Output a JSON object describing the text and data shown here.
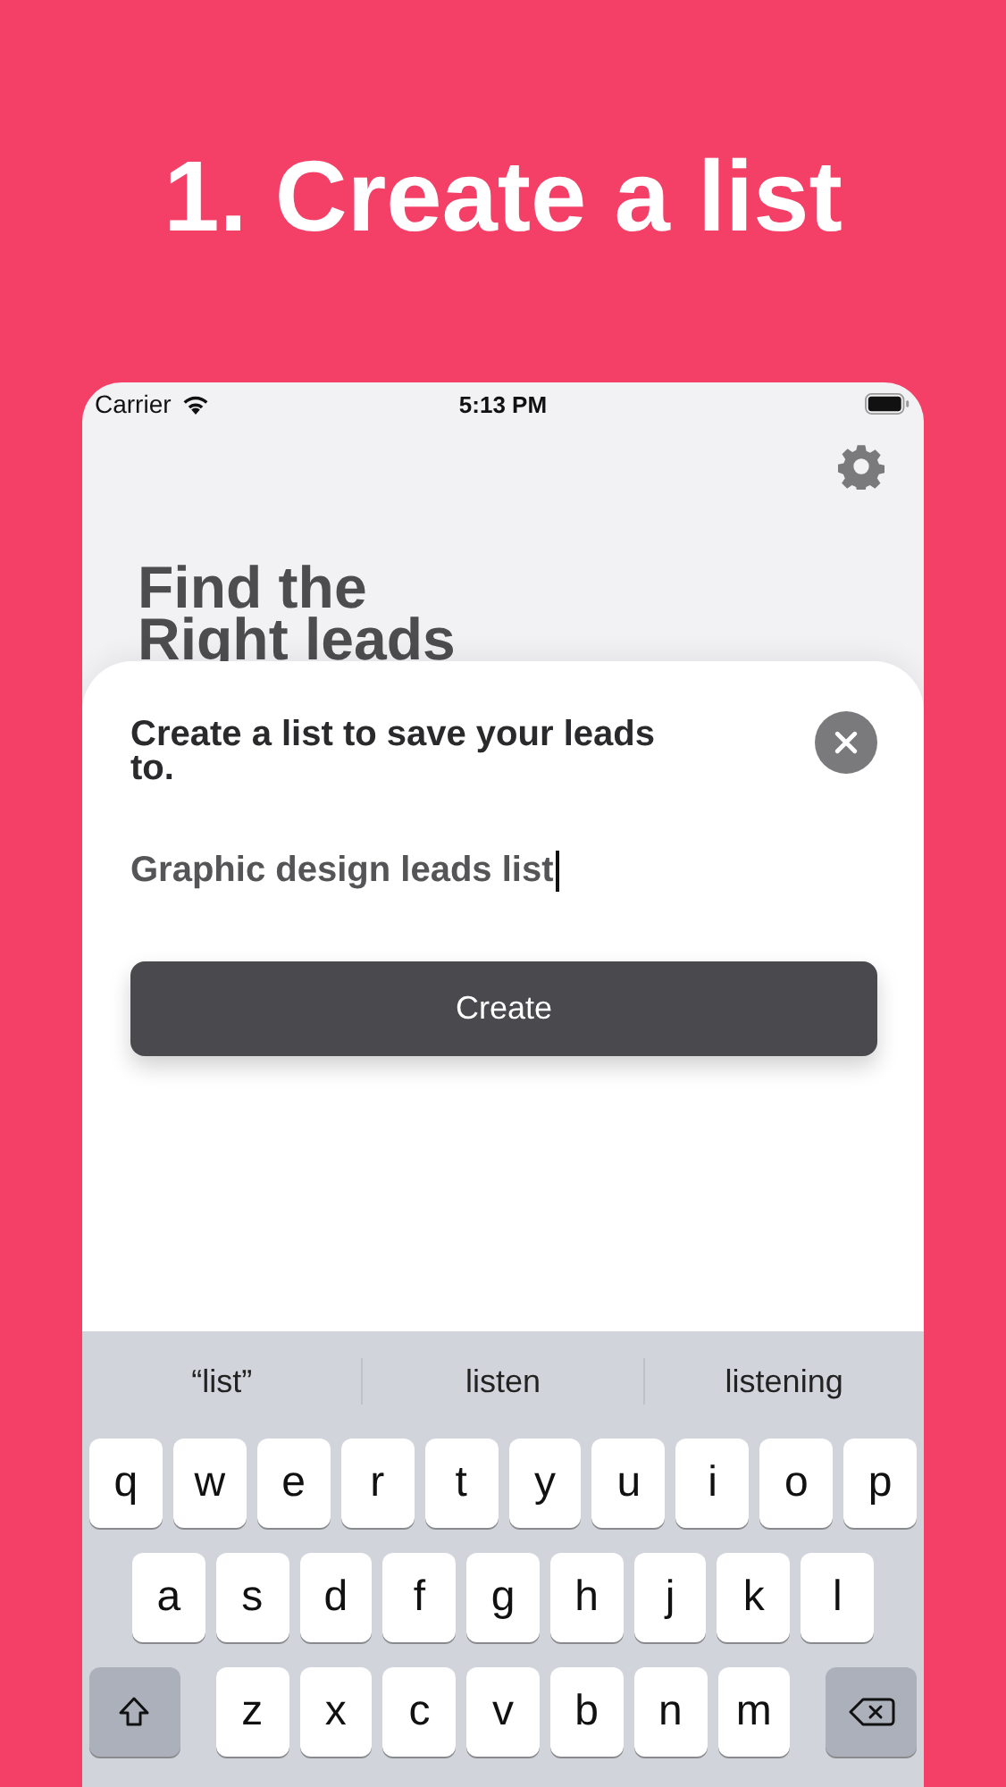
{
  "headline": "1. Create a list",
  "status_bar": {
    "carrier": "Carrier",
    "time": "5:13 PM"
  },
  "page": {
    "heading_lines": [
      "Find the",
      "Right leads"
    ]
  },
  "sheet": {
    "prompt": "Create a list to save your leads to.",
    "list_name": {
      "value": "Graphic design leads list",
      "focused": true
    },
    "create_button": "Create"
  },
  "keyboard": {
    "suggestions": [
      "“list”",
      "listen",
      "listening"
    ],
    "rows": [
      [
        {
          "kind": "letter",
          "label": "q"
        },
        {
          "kind": "letter",
          "label": "w"
        },
        {
          "kind": "letter",
          "label": "e"
        },
        {
          "kind": "letter",
          "label": "r"
        },
        {
          "kind": "letter",
          "label": "t"
        },
        {
          "kind": "letter",
          "label": "y"
        },
        {
          "kind": "letter",
          "label": "u"
        },
        {
          "kind": "letter",
          "label": "i"
        },
        {
          "kind": "letter",
          "label": "o"
        },
        {
          "kind": "letter",
          "label": "p"
        }
      ],
      [
        {
          "kind": "letter",
          "label": "a"
        },
        {
          "kind": "letter",
          "label": "s"
        },
        {
          "kind": "letter",
          "label": "d"
        },
        {
          "kind": "letter",
          "label": "f"
        },
        {
          "kind": "letter",
          "label": "g"
        },
        {
          "kind": "letter",
          "label": "h"
        },
        {
          "kind": "letter",
          "label": "j"
        },
        {
          "kind": "letter",
          "label": "k"
        },
        {
          "kind": "letter",
          "label": "l"
        }
      ],
      [
        {
          "kind": "shift"
        },
        {
          "kind": "letter",
          "label": "z"
        },
        {
          "kind": "letter",
          "label": "x"
        },
        {
          "kind": "letter",
          "label": "c"
        },
        {
          "kind": "letter",
          "label": "v"
        },
        {
          "kind": "letter",
          "label": "b"
        },
        {
          "kind": "letter",
          "label": "n"
        },
        {
          "kind": "letter",
          "label": "m"
        },
        {
          "kind": "backspace"
        }
      ]
    ]
  }
}
